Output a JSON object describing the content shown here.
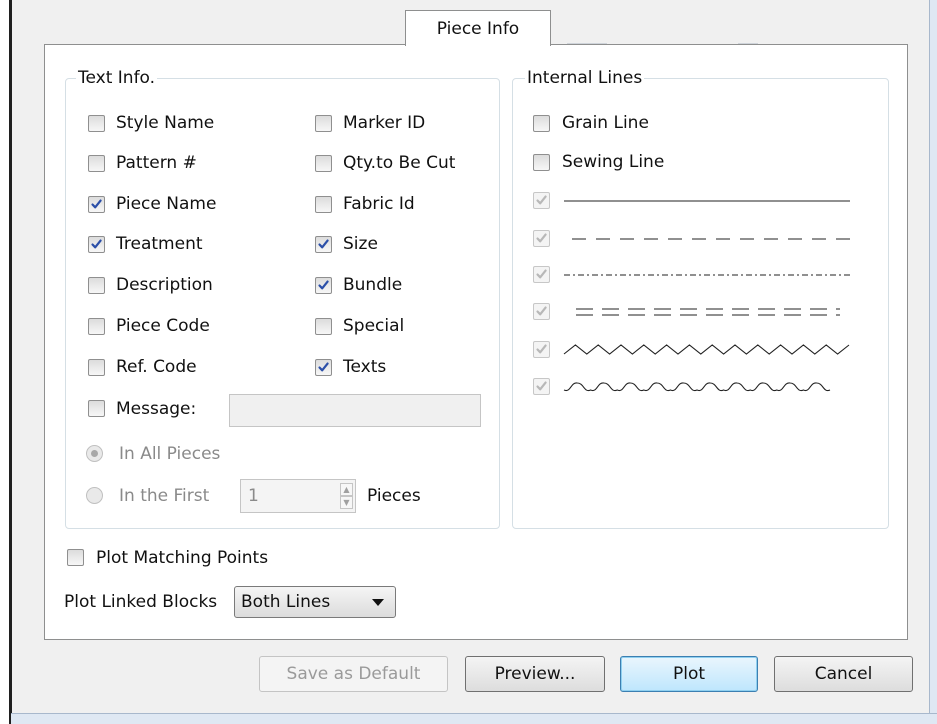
{
  "tab": {
    "label": "Piece Info"
  },
  "text_info": {
    "title": "Text Info.",
    "col1": [
      {
        "label": "Style Name",
        "checked": false
      },
      {
        "label": "Pattern #",
        "checked": false
      },
      {
        "label": "Piece Name",
        "checked": true
      },
      {
        "label": "Treatment",
        "checked": true
      },
      {
        "label": "Description",
        "checked": false
      },
      {
        "label": "Piece Code",
        "checked": false
      },
      {
        "label": "Ref. Code",
        "checked": false
      }
    ],
    "col2": [
      {
        "label": "Marker ID",
        "checked": false
      },
      {
        "label": "Qty.to Be Cut",
        "checked": false
      },
      {
        "label": "Fabric Id",
        "checked": false
      },
      {
        "label": "Size",
        "checked": true
      },
      {
        "label": "Bundle",
        "checked": true
      },
      {
        "label": "Special",
        "checked": false
      },
      {
        "label": "Texts",
        "checked": true
      }
    ],
    "message": {
      "label": "Message:",
      "checked": false,
      "value": ""
    },
    "in_all_pieces": {
      "label": "In All Pieces",
      "selected": true
    },
    "in_the_first": {
      "label": "In the First",
      "selected": false,
      "value": "1",
      "suffix": "Pieces"
    }
  },
  "internal_lines": {
    "title": "Internal Lines",
    "grain_line": {
      "label": "Grain Line",
      "checked": false
    },
    "sewing_line": {
      "label": "Sewing Line",
      "checked": false
    },
    "line_styles": [
      {
        "style": "solid-line",
        "checked": true
      },
      {
        "style": "dashed-line",
        "checked": true
      },
      {
        "style": "dash-dot-line",
        "checked": true
      },
      {
        "style": "double-dashed-line",
        "checked": true
      },
      {
        "style": "zigzag-line",
        "checked": true
      },
      {
        "style": "wavy-line",
        "checked": true
      }
    ]
  },
  "plot_matching_points": {
    "label": "Plot Matching Points",
    "checked": false
  },
  "plot_linked_blocks": {
    "label": "Plot Linked Blocks",
    "selected": "Both Lines"
  },
  "buttons": {
    "save_default": "Save as Default",
    "preview": "Preview...",
    "plot": "Plot",
    "cancel": "Cancel"
  }
}
